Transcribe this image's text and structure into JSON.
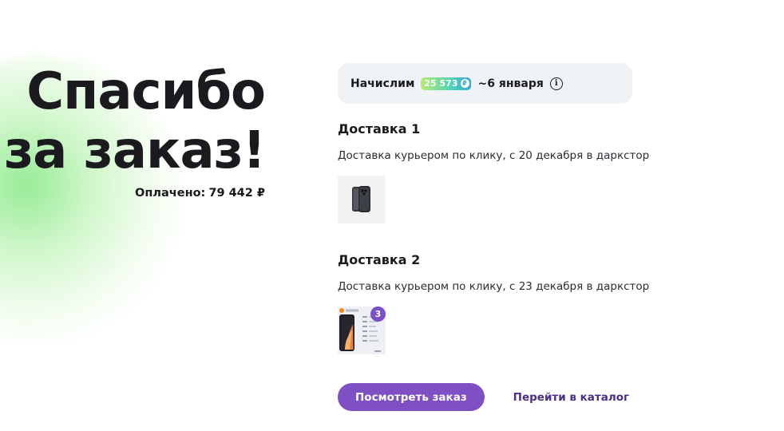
{
  "hero": {
    "title_line1": "Спасибо",
    "title_line2": "за заказ!",
    "paid_label": "Оплачено:",
    "paid_amount": "79 442 ₽"
  },
  "bonus": {
    "label": "Начислим",
    "points": "25 573",
    "coin_icon": "bonus-coin-icon",
    "date": "~6 января",
    "info_icon": "info-icon"
  },
  "deliveries": [
    {
      "title": "Доставка 1",
      "description": "Доставка курьером по клику, с 20 декабря в даркстор",
      "product_image": "iphone-image"
    },
    {
      "title": "Доставка 2",
      "description": "Доставка курьером по клику, с 23 декабря в даркстор",
      "product_image": "redmi-phone-image",
      "quantity_badge": "3"
    }
  ],
  "actions": {
    "view_order": "Посмотреть заказ",
    "go_to_catalog": "Перейти в каталог"
  },
  "colors": {
    "primary": "#7e50c4",
    "link": "#4b2f86",
    "badge": "#7b4fc4",
    "panel": "#f0f3f6",
    "glow": "#84e884"
  }
}
